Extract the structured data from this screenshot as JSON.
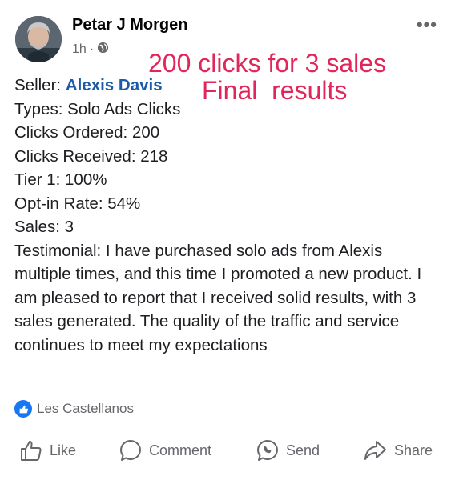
{
  "post": {
    "author": "Petar J Morgen",
    "time": "1h",
    "privacy_icon": "globe-icon",
    "more_label": "•••"
  },
  "overlay": {
    "line1": "200 clicks for 3 sales",
    "line2": "Final  results",
    "color": "#e0265a"
  },
  "details": {
    "seller_label": "Seller:",
    "seller_name": "Alexis Davis",
    "types": "Types: Solo Ads Clicks",
    "clicks_ordered": "Clicks Ordered: 200",
    "clicks_received": "Clicks Received: 218",
    "tier1": "Tier 1: 100%",
    "optin": "Opt-in Rate: 54%",
    "sales": "Sales: 3",
    "testimonial": "Testimonial: I have purchased solo ads from Alexis multiple times, and this time I promoted a new product. I am pleased to report that I received solid results, with 3 sales generated. The quality of the traffic and service continues to meet my expectations"
  },
  "reactions": {
    "icon": "like-reaction-icon",
    "names": "Les Castellanos"
  },
  "actions": {
    "like": "Like",
    "comment": "Comment",
    "send": "Send",
    "share": "Share"
  },
  "colors": {
    "link": "#1a5aa8",
    "secondary_text": "#65676b",
    "like_blue": "#1877f2"
  }
}
